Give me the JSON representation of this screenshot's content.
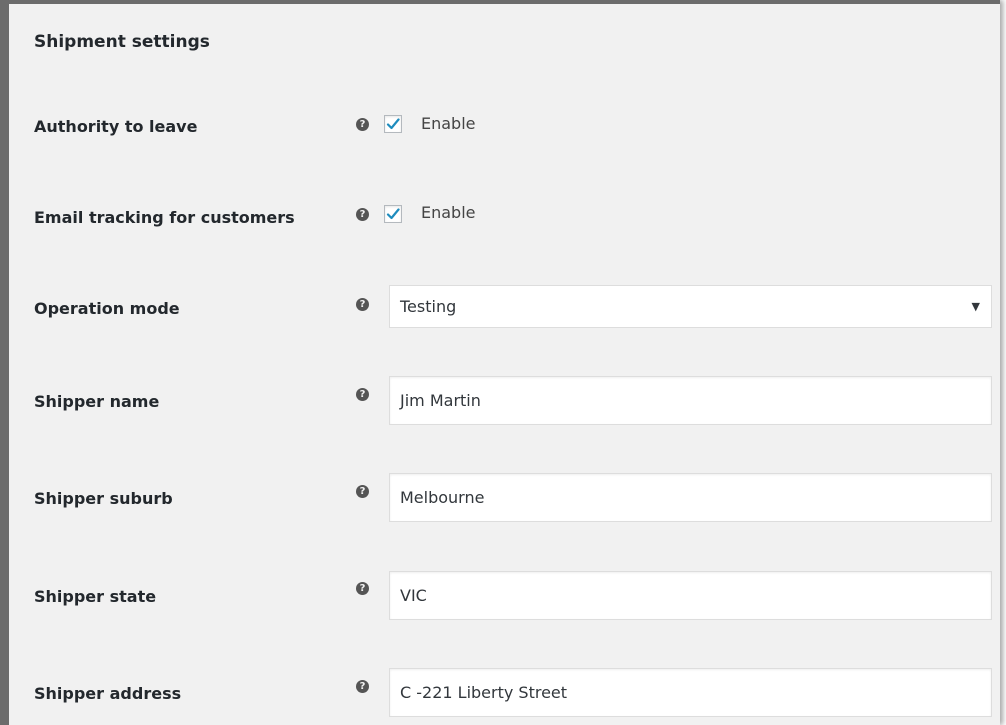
{
  "section": {
    "title": "Shipment settings"
  },
  "authority_to_leave": {
    "label": "Authority to leave",
    "checkbox_label": "Enable",
    "checked": true
  },
  "email_tracking": {
    "label": "Email tracking for customers",
    "checkbox_label": "Enable",
    "checked": true
  },
  "operation_mode": {
    "label": "Operation mode",
    "selected": "Testing"
  },
  "shipper_name": {
    "label": "Shipper name",
    "value": "Jim Martin"
  },
  "shipper_suburb": {
    "label": "Shipper suburb",
    "value": "Melbourne"
  },
  "shipper_state": {
    "label": "Shipper state",
    "value": "VIC"
  },
  "shipper_address": {
    "label": "Shipper address",
    "value": "C -221 Liberty Street"
  },
  "icons": {
    "help": "help-icon",
    "check": "checkmark-icon",
    "dropdown": "caret-down-icon"
  },
  "colors": {
    "panel_bg": "#f1f1f1",
    "frame_border": "#6c6c6c",
    "checkmark": "#1e8cbe",
    "label_text": "#23282d"
  }
}
